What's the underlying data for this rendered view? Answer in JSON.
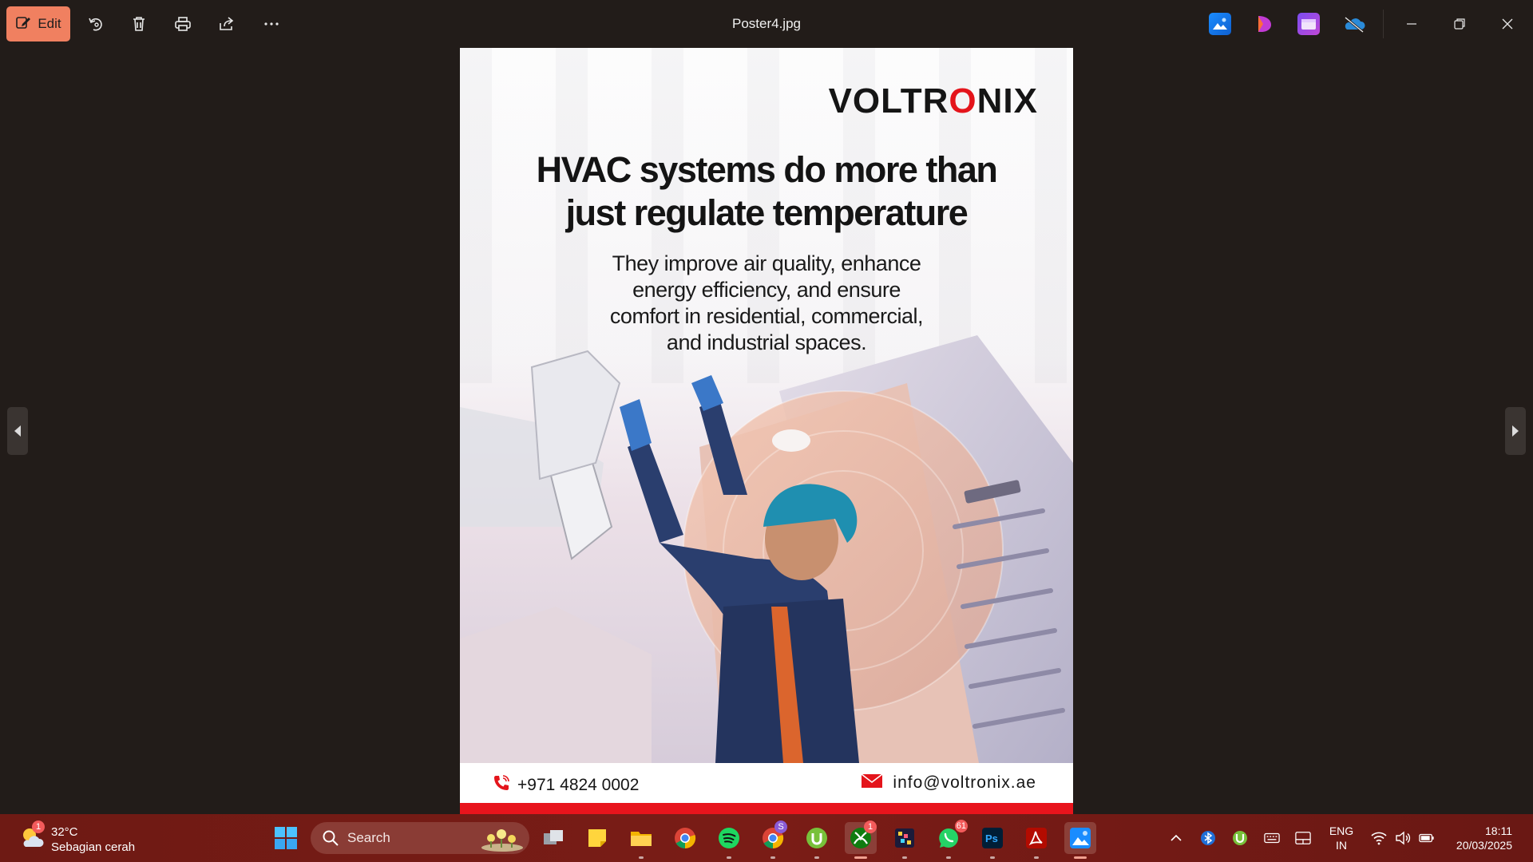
{
  "toolbar": {
    "edit_label": "Edit",
    "window_title": "Poster4.jpg"
  },
  "poster": {
    "brand": "VOLTR",
    "brand_o": "O",
    "brand_end": "NIX",
    "headline_line1": "HVAC systems do more than",
    "headline_line2": "just regulate temperature",
    "sub_line1": "They improve air quality, enhance",
    "sub_line2": "energy efficiency, and ensure",
    "sub_line3": "comfort in residential, commercial,",
    "sub_line4": "and industrial spaces.",
    "phone": "+971 4824 0002",
    "email": "info@voltronix.ae"
  },
  "taskbar": {
    "weather_temp": "32°C",
    "weather_desc": "Sebagian cerah",
    "weather_badge": "1",
    "search_label": "Search",
    "chrome_profile_badge": "S",
    "xbox_badge": "1",
    "whatsapp_badge": "61",
    "lang_line1": "ENG",
    "lang_line2": "IN",
    "time": "18:11",
    "date": "20/03/2025"
  },
  "colors": {
    "accent_edit": "#f08060",
    "brand_red": "#e4141b",
    "taskbar_bg": "#7a1c16"
  }
}
